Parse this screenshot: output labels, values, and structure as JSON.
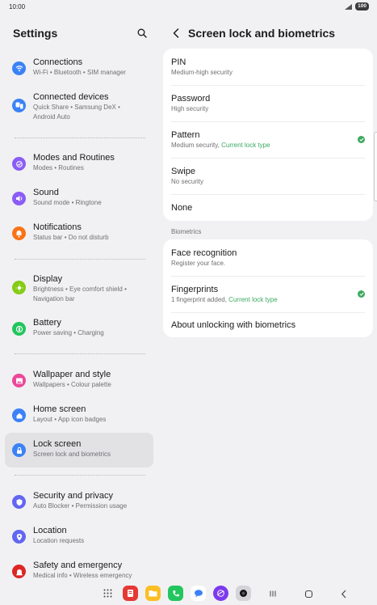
{
  "status_bar": {
    "time": "10:00",
    "battery": "100"
  },
  "settings": {
    "title": "Settings",
    "items": [
      {
        "label": "Connections",
        "sub": "Wi-Fi  •  Bluetooth  •  SIM manager",
        "icon": "wifi-icon",
        "color": "#3b82f6"
      },
      {
        "label": "Connected devices",
        "sub": "Quick Share  •  Samsung DeX  •",
        "sub2": "Android Auto",
        "icon": "devices-icon",
        "color": "#3b82f6"
      },
      {
        "label": "Modes and Routines",
        "sub": "Modes  •  Routines",
        "icon": "routines-icon",
        "color": "#8b5cf6"
      },
      {
        "label": "Sound",
        "sub": "Sound mode  •  Ringtone",
        "icon": "sound-icon",
        "color": "#8b5cf6"
      },
      {
        "label": "Notifications",
        "sub": "Status bar  •  Do not disturb",
        "icon": "bell-icon",
        "color": "#f97316"
      },
      {
        "label": "Display",
        "sub": "Brightness  •  Eye comfort shield  •",
        "sub2": "Navigation bar",
        "icon": "sun-icon",
        "color": "#84cc16"
      },
      {
        "label": "Battery",
        "sub": "Power saving  •  Charging",
        "icon": "battery-icon",
        "color": "#22c55e"
      },
      {
        "label": "Wallpaper and style",
        "sub": "Wallpapers  •  Colour palette",
        "icon": "wallpaper-icon",
        "color": "#ec4899"
      },
      {
        "label": "Home screen",
        "sub": "Layout  •  App icon badges",
        "icon": "home-icon",
        "color": "#3b82f6"
      },
      {
        "label": "Lock screen",
        "sub": "Screen lock and biometrics",
        "icon": "lock-icon",
        "color": "#3b82f6"
      },
      {
        "label": "Security and privacy",
        "sub": "Auto Blocker  •  Permission usage",
        "icon": "shield-icon",
        "color": "#6366f1"
      },
      {
        "label": "Location",
        "sub": "Location requests",
        "icon": "location-icon",
        "color": "#6366f1"
      },
      {
        "label": "Safety and emergency",
        "sub": "Medical info  •  Wireless emergency",
        "icon": "emergency-icon",
        "color": "#dc2626"
      }
    ]
  },
  "detail": {
    "title": "Screen lock and biometrics",
    "lock_types": [
      {
        "label": "PIN",
        "sub": "Medium-high security"
      },
      {
        "label": "Password",
        "sub": "High security"
      },
      {
        "label": "Pattern",
        "sub": "Medium security, ",
        "sub_accent": "Current lock type",
        "checked": true
      },
      {
        "label": "Swipe",
        "sub": "No security"
      },
      {
        "label": "None"
      }
    ],
    "biometrics_header": "Biometrics",
    "biometrics": [
      {
        "label": "Face recognition",
        "sub": "Register your face."
      },
      {
        "label": "Fingerprints",
        "sub": "1 fingerprint added, ",
        "sub_accent": "Current lock type",
        "checked": true
      },
      {
        "label": "About unlocking with biometrics"
      }
    ]
  },
  "colors": {
    "accent_green": "#3da860",
    "selected_bg": "#e2e2e5",
    "card_bg": "#ffffff",
    "page_bg": "#f1f1f3"
  },
  "taskbar": {
    "apps": [
      "apps-grid-icon",
      "flip-notes-icon",
      "my-files-icon",
      "phone-icon",
      "messages-icon",
      "internet-icon",
      "camera-icon"
    ],
    "nav": [
      "recents-icon",
      "home-nav-icon",
      "back-nav-icon"
    ]
  }
}
